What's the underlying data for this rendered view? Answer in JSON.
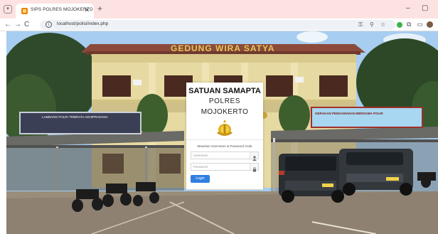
{
  "browser": {
    "tab_title": "SIPS POLRES MOJOKERTO",
    "tab_close_glyph": "✕",
    "new_tab_glyph": "+",
    "url": "localhost/polisi/index.php",
    "nav": {
      "back": "←",
      "forward": "→",
      "reload": "C"
    },
    "window": {
      "minimize": "–",
      "maximize": "▢"
    },
    "icons": [
      "tab-list-icon",
      "site-info-icon",
      "key-icon",
      "zoom-icon",
      "bookmark-star-icon",
      "extension-icon",
      "sidebar-icon",
      "profile-avatar-icon"
    ]
  },
  "scene": {
    "building_name": "GEDUNG WIRA SATYA",
    "banner_left": "LAMBANG POLRI TRIBRATA ADHIPRADANA",
    "banner_right": "GERAKAN PENGAMANAN BERSAMA POLRI"
  },
  "login": {
    "title": "SATUAN SAMAPTA",
    "subtitle": "POLRES",
    "region": "MOJOKERTO",
    "prompt": "Masukan Username & Password Anda",
    "username_placeholder": "Username",
    "password_placeholder": "Password",
    "button_label": "Login"
  },
  "colors": {
    "tabstrip": "#fde2e2",
    "login_button": "#2f7fe0",
    "building_letters": "#e8c45c"
  }
}
